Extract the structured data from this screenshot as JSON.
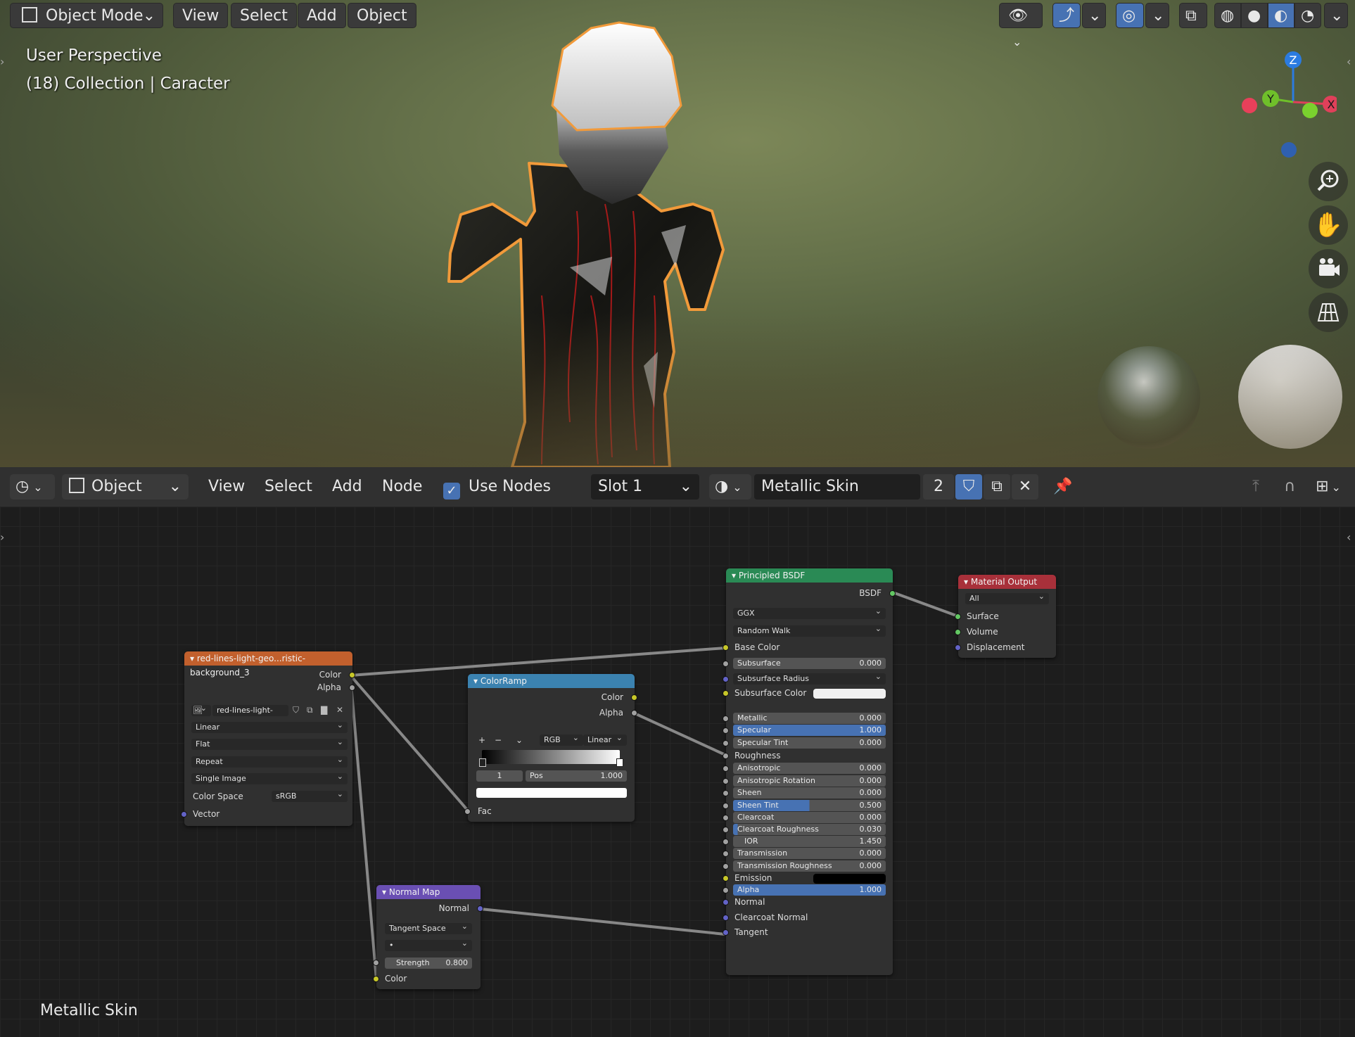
{
  "viewport": {
    "mode_label": "Object Mode",
    "menu": [
      "View",
      "Select",
      "Add",
      "Object"
    ],
    "perspective": "User Perspective",
    "collection_info": "(18) Collection | Caracter",
    "gizmo_axes": [
      "Z",
      "Y",
      "X"
    ]
  },
  "node_editor": {
    "header": {
      "object_label": "Object",
      "menu": [
        "View",
        "Select",
        "Add",
        "Node"
      ],
      "use_nodes_label": "Use Nodes",
      "use_nodes_checked": true,
      "slot_label": "Slot 1",
      "material_name": "Metallic Skin",
      "user_count": "2"
    },
    "footer_label": "Metallic Skin",
    "image_texture": {
      "title": "red-lines-light-geo...ristic-background_3",
      "outputs": [
        "Color",
        "Alpha"
      ],
      "image_name": "red-lines-light-g...",
      "interpolation": "Linear",
      "projection": "Flat",
      "extension": "Repeat",
      "source": "Single Image",
      "color_space_label": "Color Space",
      "color_space": "sRGB",
      "input": "Vector"
    },
    "color_ramp": {
      "title": "ColorRamp",
      "outputs": [
        "Color",
        "Alpha"
      ],
      "add": "+",
      "remove": "−",
      "mode": "RGB",
      "interpolation": "Linear",
      "index": "1",
      "pos_label": "Pos",
      "pos_value": "1.000",
      "input": "Fac"
    },
    "normal_map": {
      "title": "Normal Map",
      "output": "Normal",
      "space": "Tangent Space",
      "strength_label": "Strength",
      "strength_value": "0.800",
      "input": "Color"
    },
    "principled": {
      "title": "Principled BSDF",
      "output": "BSDF",
      "distribution": "GGX",
      "subsurface_method": "Random Walk",
      "base_color_label": "Base Color",
      "subsurface_radius": "Subsurface Radius",
      "subsurface_color_label": "Subsurface Color",
      "roughness_label": "Roughness",
      "emission_label": "Emission",
      "normal_label": "Normal",
      "clearcoat_normal_label": "Clearcoat Normal",
      "tangent_label": "Tangent",
      "fields": [
        {
          "label": "Subsurface",
          "value": "0.000",
          "fill": 0
        },
        {
          "label": "Metallic",
          "value": "0.000",
          "fill": 0
        },
        {
          "label": "Specular",
          "value": "1.000",
          "fill": 1
        },
        {
          "label": "Specular Tint",
          "value": "0.000",
          "fill": 0
        },
        {
          "label": "Anisotropic",
          "value": "0.000",
          "fill": 0
        },
        {
          "label": "Anisotropic Rotation",
          "value": "0.000",
          "fill": 0
        },
        {
          "label": "Sheen",
          "value": "0.000",
          "fill": 0
        },
        {
          "label": "Sheen Tint",
          "value": "0.500",
          "fill": 0.5
        },
        {
          "label": "Clearcoat",
          "value": "0.000",
          "fill": 0
        },
        {
          "label": "Clearcoat Roughness",
          "value": "0.030",
          "fill": 0.03
        },
        {
          "label": "IOR",
          "value": "1.450",
          "fill": 0
        },
        {
          "label": "Transmission",
          "value": "0.000",
          "fill": 0
        },
        {
          "label": "Transmission Roughness",
          "value": "0.000",
          "fill": 0
        },
        {
          "label": "Alpha",
          "value": "1.000",
          "fill": 1
        }
      ]
    },
    "material_output": {
      "title": "Material Output",
      "target": "All",
      "inputs": [
        "Surface",
        "Volume",
        "Displacement"
      ]
    }
  },
  "colors": {
    "accent": "#4772b3",
    "selection_outline": "#f29a3a",
    "node_texture": "#c2602d",
    "node_converter": "#3b82b0",
    "node_vector": "#6a4fb3",
    "node_shader": "#2a8a55",
    "node_output": "#a8303a"
  }
}
